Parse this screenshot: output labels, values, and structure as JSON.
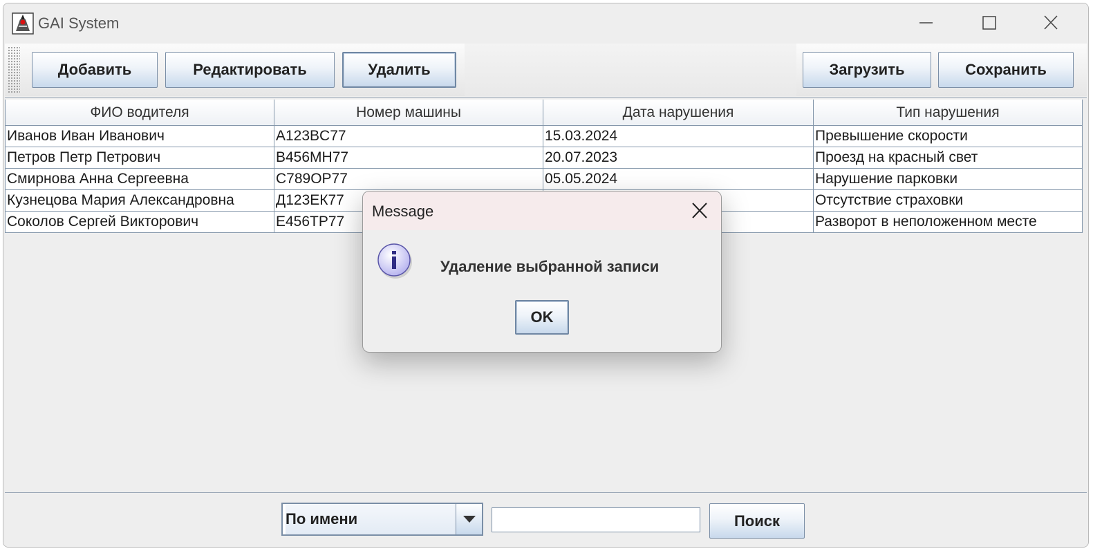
{
  "window": {
    "title": "GAI System"
  },
  "toolbar": {
    "add_label": "Добавить",
    "edit_label": "Редактировать",
    "delete_label": "Удалить",
    "load_label": "Загрузить",
    "save_label": "Сохранить"
  },
  "table": {
    "columns": [
      "ФИО водителя",
      "Номер машины",
      "Дата нарушения",
      "Тип нарушения"
    ],
    "rows": [
      [
        "Иванов Иван Иванович",
        "A123BC77",
        "15.03.2024",
        "Превышение скорости"
      ],
      [
        "Петров Петр Петрович",
        "B456MH77",
        "20.07.2023",
        "Проезд на красный свет"
      ],
      [
        "Смирнова Анна Сергеевна",
        "C789OP77",
        "05.05.2024",
        "Нарушение парковки"
      ],
      [
        "Кузнецова Мария Александровна",
        "Д123ЕК77",
        "",
        "Отсутствие страховки"
      ],
      [
        "Соколов Сергей Викторович",
        "E456TP77",
        "",
        "Разворот в неположенном месте"
      ]
    ]
  },
  "search": {
    "mode": "По имени",
    "query": "",
    "button_label": "Поиск"
  },
  "dialog": {
    "title": "Message",
    "message": "Удаление выбранной записи",
    "ok_label": "OK"
  },
  "icons": {
    "app": "java-duke-icon",
    "minimize": "minimize-icon",
    "maximize": "maximize-icon",
    "close": "close-icon",
    "info": "info-icon",
    "dropdown": "chevron-down-icon"
  }
}
